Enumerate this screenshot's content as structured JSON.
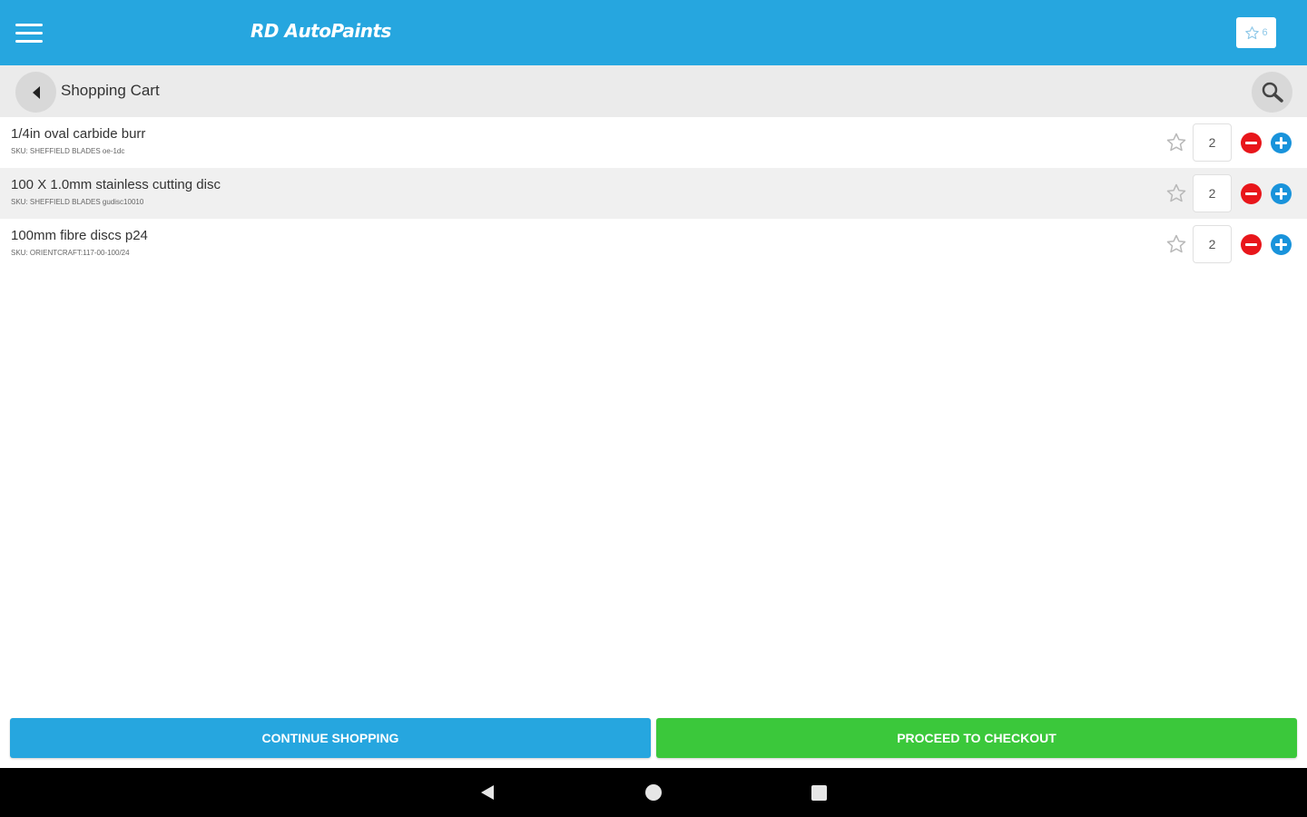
{
  "app": {
    "brand": "RD AutoPaints",
    "favorites_count": "6"
  },
  "subheader": {
    "title": "Shopping Cart"
  },
  "cart": {
    "items": [
      {
        "name": "1/4in oval carbide burr",
        "sku": "SKU: SHEFFIELD BLADES oe-1dc",
        "quantity": "2"
      },
      {
        "name": "100 X 1.0mm stainless cutting disc",
        "sku": "SKU: SHEFFIELD BLADES gudisc10010",
        "quantity": "2"
      },
      {
        "name": "100mm fibre discs p24",
        "sku": "SKU: ORIENTCRAFT:117-00-100/24",
        "quantity": "2"
      }
    ]
  },
  "actions": {
    "continue_label": "CONTINUE SHOPPING",
    "checkout_label": "PROCEED TO CHECKOUT"
  },
  "icons": {
    "menu": "hamburger-menu-icon",
    "favorites": "star-icon",
    "back": "back-arrow-icon",
    "search": "search-icon",
    "row_favorite": "star-outline-icon",
    "decrease": "minus-circle-icon",
    "increase": "plus-circle-icon"
  },
  "colors": {
    "primary": "#26a6df",
    "checkout": "#3bc83b",
    "decrease": "#e8161b",
    "increase": "#1993db"
  }
}
